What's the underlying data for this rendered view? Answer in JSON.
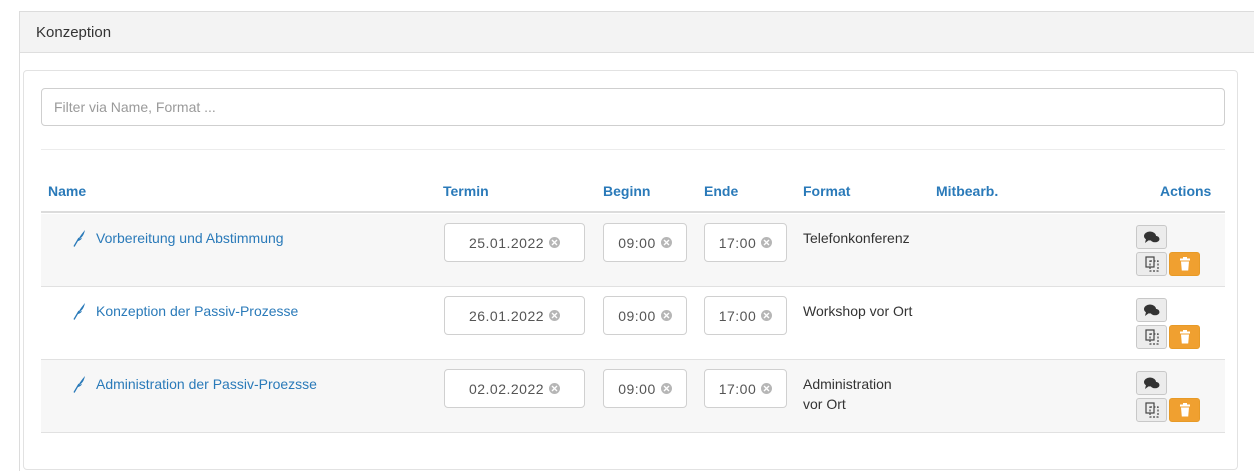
{
  "panel": {
    "title": "Konzeption"
  },
  "filter": {
    "placeholder": "Filter via Name, Format ...",
    "value": ""
  },
  "columns": {
    "name": "Name",
    "termin": "Termin",
    "beginn": "Beginn",
    "ende": "Ende",
    "format": "Format",
    "mitbearb": "Mitbearb.",
    "actions": "Actions"
  },
  "rows": [
    {
      "name": "Vorbereitung und Abstimmung",
      "termin": "25.01.2022",
      "beginn": "09:00",
      "ende": "17:00",
      "format": "Telefonkonferenz"
    },
    {
      "name": "Konzeption der Passiv-Prozesse",
      "termin": "26.01.2022",
      "beginn": "09:00",
      "ende": "17:00",
      "format": "Workshop vor Ort"
    },
    {
      "name": "Administration der Passiv-Proezsse",
      "termin": "02.02.2022",
      "beginn": "09:00",
      "ende": "17:00",
      "format": "Administration vor Ort"
    }
  ],
  "icons": {
    "row": "feather-icon",
    "comment": "comments-icon",
    "copy": "copy-icon",
    "delete": "trash-icon",
    "clear": "clear-circle-icon"
  },
  "colors": {
    "link": "#2a7ab9",
    "delete_button": "#f0a030",
    "header_bg": "#f3f3f3"
  }
}
